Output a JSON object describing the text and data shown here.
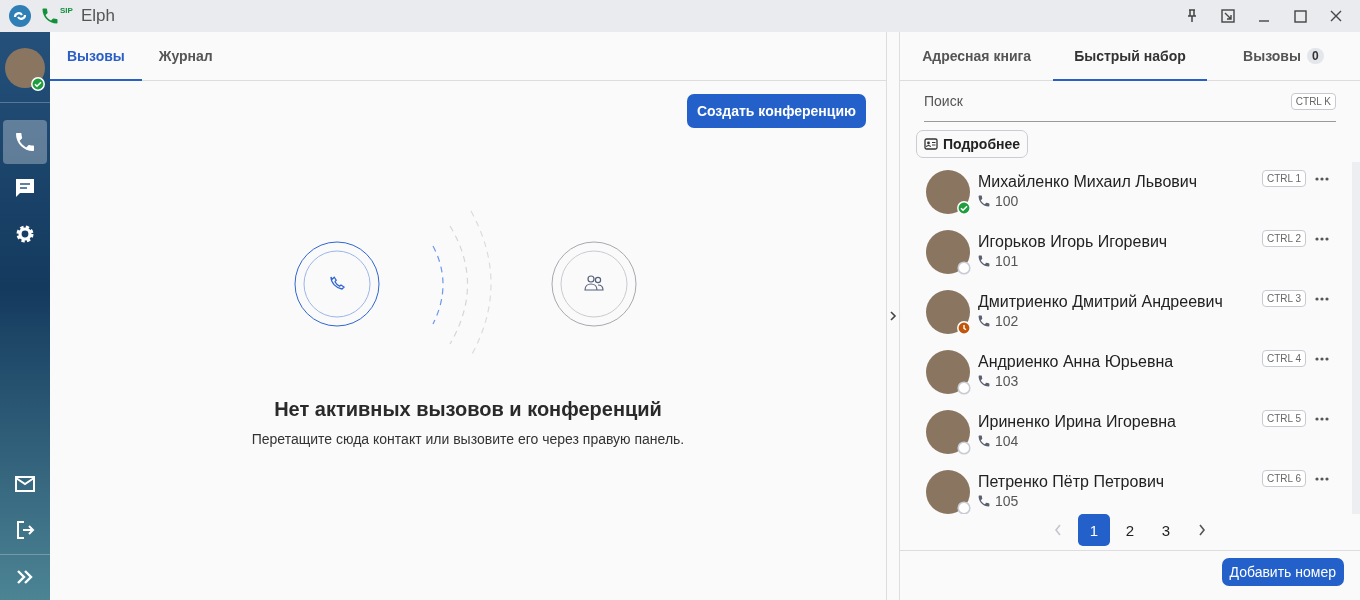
{
  "window": {
    "title": "Elph",
    "badge": "SIP"
  },
  "rail": {
    "top": [
      {
        "selected": true
      },
      {
        "selected": false
      },
      {
        "selected": false
      }
    ],
    "user_status": {
      "kind": "online",
      "color": "#1e9e3e"
    }
  },
  "main": {
    "tabs": [
      {
        "label": "Вызовы",
        "selected": true
      },
      {
        "label": "Журнал",
        "selected": false
      }
    ],
    "create_button": "Создать конференцию",
    "empty_title": "Нет активных вызовов и конференций",
    "empty_text": "Перетащите сюда контакт или вызовите его через правую панель."
  },
  "right": {
    "tabs": [
      {
        "label": "Адресная книга",
        "selected": false
      },
      {
        "label": "Быстрый набор",
        "selected": true
      },
      {
        "label": "Вызовы",
        "selected": false,
        "count": "0"
      }
    ],
    "search": {
      "placeholder": "Поиск",
      "shortcut": "CTRL K"
    },
    "details_button": "Подробнее",
    "contacts": [
      {
        "name": "Михайленко Михаил Львович",
        "ext": "100",
        "shortcut": "CTRL 1",
        "status": {
          "kind": "online",
          "color": "#1e9e3e"
        }
      },
      {
        "name": "Игорьков Игорь Игоревич",
        "ext": "101",
        "shortcut": "CTRL 2",
        "status": {
          "kind": "offline",
          "color": "#c9cdd3"
        }
      },
      {
        "name": "Дмитриенко Дмитрий Андреевич",
        "ext": "102",
        "shortcut": "CTRL 3",
        "status": {
          "kind": "away",
          "color": "#c2570c"
        }
      },
      {
        "name": "Андриенко Анна Юрьевна",
        "ext": "103",
        "shortcut": "CTRL 4",
        "status": {
          "kind": "offline",
          "color": "#c9cdd3"
        }
      },
      {
        "name": "Ириненко Ирина Игоревна",
        "ext": "104",
        "shortcut": "CTRL 5",
        "status": {
          "kind": "offline",
          "color": "#c9cdd3"
        }
      },
      {
        "name": "Петренко Пётр Петрович",
        "ext": "105",
        "shortcut": "CTRL 6",
        "status": {
          "kind": "offline",
          "color": "#c9cdd3"
        }
      }
    ],
    "pages": [
      {
        "label": "1",
        "selected": true
      },
      {
        "label": "2",
        "selected": false
      },
      {
        "label": "3",
        "selected": false
      }
    ],
    "prev_disabled": true,
    "add_button": "Добавить номер"
  }
}
